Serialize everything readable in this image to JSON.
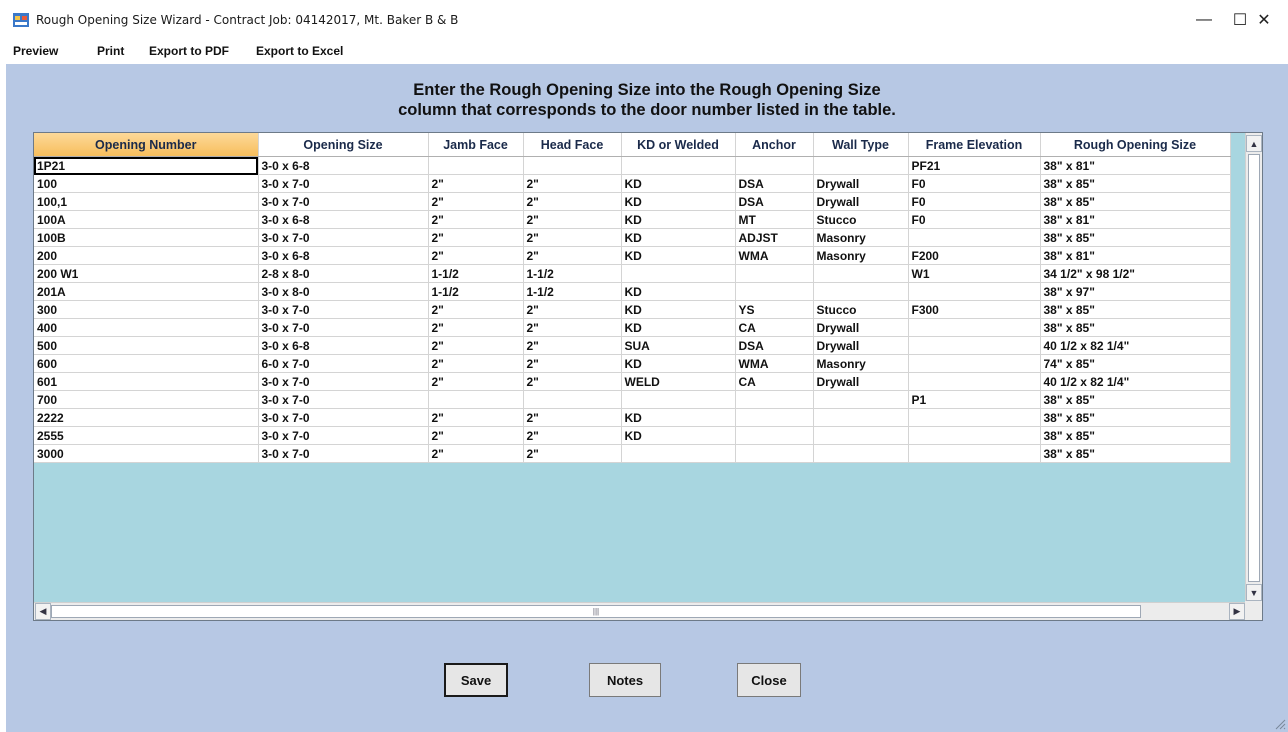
{
  "window": {
    "title": "Rough Opening Size Wizard - Contract Job: 04142017, Mt. Baker B & B",
    "controls": {
      "minimize": "—",
      "maximize": "☐",
      "close": "✕"
    }
  },
  "menu": [
    "Preview",
    "Print",
    "Export to PDF",
    "Export to Excel"
  ],
  "instructions": {
    "line1": "Enter the Rough Opening Size into the Rough Opening Size",
    "line2": "column that corresponds to the door number listed in the table."
  },
  "grid": {
    "columns": [
      "Opening Number",
      "Opening Size",
      "Jamb Face",
      "Head Face",
      "KD or Welded",
      "Anchor",
      "Wall Type",
      "Frame Elevation",
      "Rough Opening Size"
    ],
    "selected_column": "Opening Number",
    "rows": [
      [
        "1P21",
        "3-0 x 6-8",
        "",
        "",
        "",
        "",
        "",
        "PF21",
        "38\" x 81\""
      ],
      [
        "100",
        "3-0 x 7-0",
        "2\"",
        "2\"",
        "KD",
        "DSA",
        "Drywall",
        "F0",
        "38\" x 85\""
      ],
      [
        "100,1",
        "3-0 x 7-0",
        "2\"",
        "2\"",
        "KD",
        "DSA",
        "Drywall",
        "F0",
        "38\" x 85\""
      ],
      [
        "100A",
        "3-0 x 6-8",
        "2\"",
        "2\"",
        "KD",
        "MT",
        "Stucco",
        "F0",
        "38\" x 81\""
      ],
      [
        "100B",
        "3-0 x 7-0",
        "2\"",
        "2\"",
        "KD",
        "ADJST",
        "Masonry",
        "",
        "38\" x 85\""
      ],
      [
        "200",
        "3-0 x 6-8",
        "2\"",
        "2\"",
        "KD",
        "WMA",
        "Masonry",
        "F200",
        "38\" x 81\""
      ],
      [
        "200 W1",
        "2-8 x 8-0",
        "1-1/2",
        "1-1/2",
        "",
        "",
        "",
        "W1",
        "34 1/2\" x 98 1/2\""
      ],
      [
        "201A",
        "3-0 x 8-0",
        "1-1/2",
        "1-1/2",
        "KD",
        "",
        "",
        "",
        "38\" x 97\""
      ],
      [
        "300",
        "3-0 x 7-0",
        "2\"",
        "2\"",
        "KD",
        "YS",
        "Stucco",
        "F300",
        "38\" x 85\""
      ],
      [
        "400",
        "3-0 x 7-0",
        "2\"",
        "2\"",
        "KD",
        "CA",
        "Drywall",
        "",
        "38\" x 85\""
      ],
      [
        "500",
        "3-0 x 6-8",
        "2\"",
        "2\"",
        "SUA",
        "DSA",
        "Drywall",
        "",
        "40 1/2 x 82 1/4\""
      ],
      [
        "600",
        "6-0 x 7-0",
        "2\"",
        "2\"",
        "KD",
        "WMA",
        "Masonry",
        "",
        "74\" x 85\""
      ],
      [
        "601",
        "3-0 x 7-0",
        "2\"",
        "2\"",
        "WELD",
        "CA",
        "Drywall",
        "",
        "40 1/2 x 82 1/4\""
      ],
      [
        "700",
        "3-0 x 7-0",
        "",
        "",
        "",
        "",
        "",
        "P1",
        "38\" x 85\""
      ],
      [
        "2222",
        "3-0 x 7-0",
        "2\"",
        "2\"",
        "KD",
        "",
        "",
        "",
        "38\" x 85\""
      ],
      [
        "2555",
        "3-0 x 7-0",
        "2\"",
        "2\"",
        "KD",
        "",
        "",
        "",
        "38\" x 85\""
      ],
      [
        "3000",
        "3-0 x 7-0",
        "2\"",
        "2\"",
        "",
        "",
        "",
        "",
        "38\" x 85\""
      ]
    ]
  },
  "buttons": {
    "save": "Save",
    "notes": "Notes",
    "close": "Close"
  },
  "icons": {
    "app": "wizard-app-icon",
    "resize": "resize-grip-icon"
  }
}
